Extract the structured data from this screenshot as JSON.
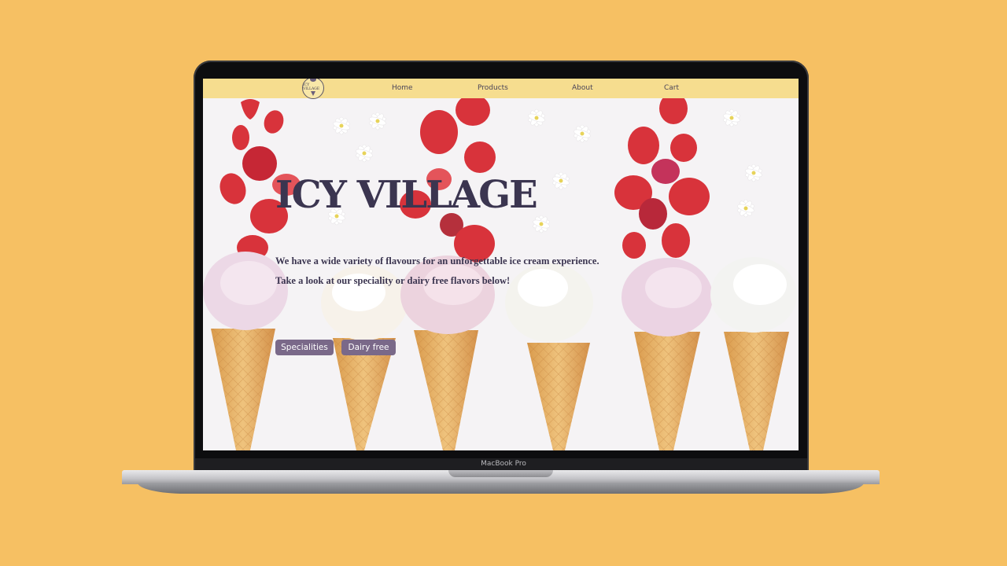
{
  "device": {
    "label": "MacBook Pro"
  },
  "nav": {
    "logo_text": "ICY VILLAGE",
    "links": [
      "Home",
      "Products",
      "About",
      "Cart"
    ]
  },
  "hero": {
    "title": "ICY VILLAGE",
    "line1": "We have a wide variety of flavours for an unforgettable ice cream experience.",
    "line2": "Take a look at our speciality or dairy free flavors below!",
    "buttons": [
      "Specialities",
      "Dairy free"
    ]
  },
  "colors": {
    "page_background": "#F6C063",
    "navbar": "#F6DD8F",
    "title": "#3B3550",
    "button": "#7A6989"
  }
}
